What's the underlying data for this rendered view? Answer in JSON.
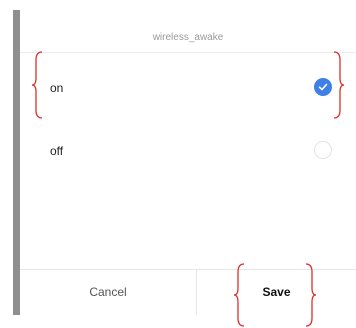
{
  "dialog": {
    "title": "wireless_awake",
    "options": [
      {
        "label": "on",
        "selected": true
      },
      {
        "label": "off",
        "selected": false
      }
    ],
    "buttons": {
      "cancel_label": "Cancel",
      "save_label": "Save"
    }
  },
  "colors": {
    "accent": "#3f80e6",
    "annotation": "#d9312b"
  },
  "icons": {
    "checked": "check-icon"
  }
}
